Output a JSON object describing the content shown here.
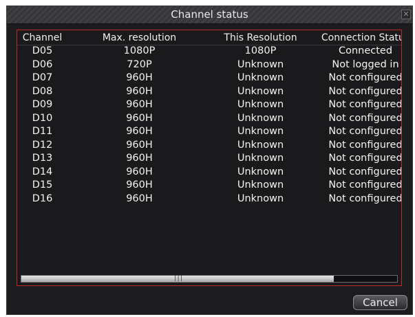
{
  "dialog": {
    "title": "Channel status",
    "close_glyph": "✕",
    "cancel_label": "Cancel"
  },
  "table": {
    "headers": {
      "channel": "Channel",
      "max_resolution": "Max. resolution",
      "this_resolution": "This Resolution",
      "connection_status": "Connection Status"
    },
    "rows": [
      {
        "channel": "D05",
        "max_resolution": "1080P",
        "this_resolution": "1080P",
        "connection_status": "Connected"
      },
      {
        "channel": "D06",
        "max_resolution": "720P",
        "this_resolution": "Unknown",
        "connection_status": "Not logged in"
      },
      {
        "channel": "D07",
        "max_resolution": "960H",
        "this_resolution": "Unknown",
        "connection_status": "Not configured"
      },
      {
        "channel": "D08",
        "max_resolution": "960H",
        "this_resolution": "Unknown",
        "connection_status": "Not configured"
      },
      {
        "channel": "D09",
        "max_resolution": "960H",
        "this_resolution": "Unknown",
        "connection_status": "Not configured"
      },
      {
        "channel": "D10",
        "max_resolution": "960H",
        "this_resolution": "Unknown",
        "connection_status": "Not configured"
      },
      {
        "channel": "D11",
        "max_resolution": "960H",
        "this_resolution": "Unknown",
        "connection_status": "Not configured"
      },
      {
        "channel": "D12",
        "max_resolution": "960H",
        "this_resolution": "Unknown",
        "connection_status": "Not configured"
      },
      {
        "channel": "D13",
        "max_resolution": "960H",
        "this_resolution": "Unknown",
        "connection_status": "Not configured"
      },
      {
        "channel": "D14",
        "max_resolution": "960H",
        "this_resolution": "Unknown",
        "connection_status": "Not configured"
      },
      {
        "channel": "D15",
        "max_resolution": "960H",
        "this_resolution": "Unknown",
        "connection_status": "Not configured"
      },
      {
        "channel": "D16",
        "max_resolution": "960H",
        "this_resolution": "Unknown",
        "connection_status": "Not configured"
      }
    ]
  },
  "scrollbar": {
    "grip_glyph": "|||"
  },
  "colors": {
    "dialog_background": "#1c1c1e",
    "frame_border": "#c0282a",
    "text": "#f4f4f4"
  },
  "icons": {
    "close": "close-icon",
    "scroll_grip": "grip-icon"
  }
}
